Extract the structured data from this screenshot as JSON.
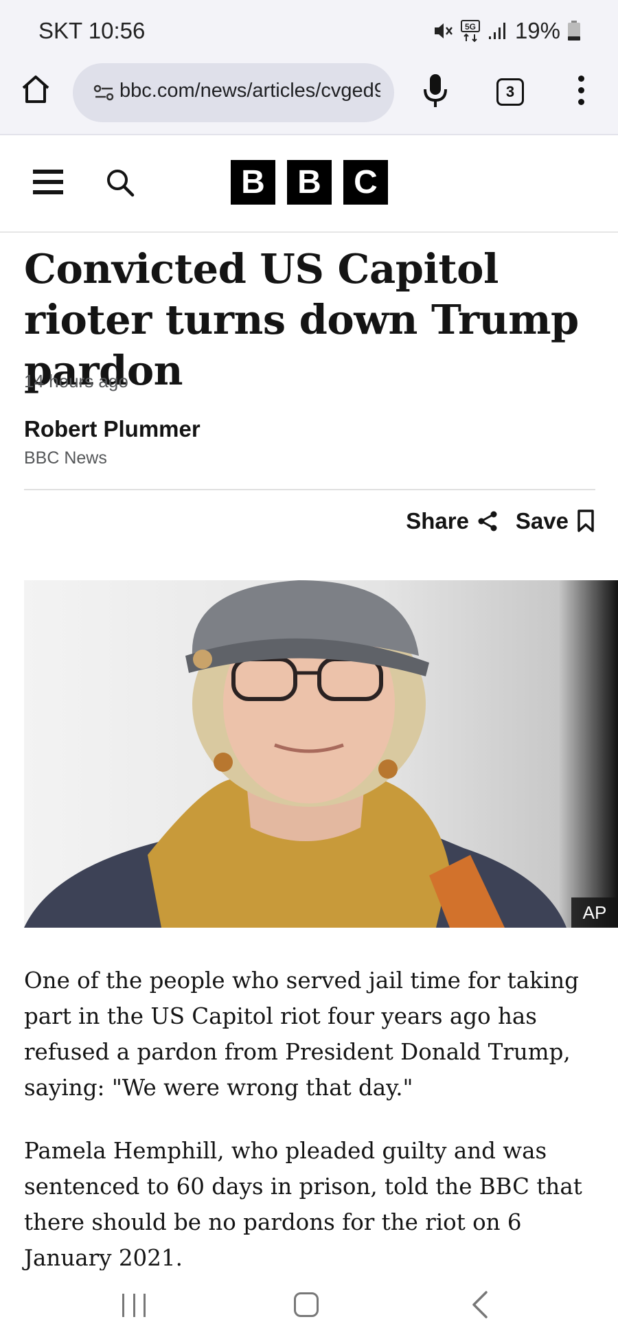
{
  "status_bar": {
    "carrier_time": "SKT 10:56",
    "network": "5G",
    "battery": "19%"
  },
  "browser": {
    "url": "bbc.com/news/articles/cvged9",
    "tab_count": "3"
  },
  "site": {
    "logo_letters": [
      "B",
      "B",
      "C"
    ]
  },
  "article": {
    "headline": "Convicted US Capitol rioter turns down Trump pardon",
    "timestamp": "14 hours ago",
    "author": "Robert Plummer",
    "outlet": "BBC News",
    "share_label": "Share",
    "save_label": "Save",
    "image_credit": "AP",
    "paragraphs": [
      "One of the people who served jail time for taking part in the US Capitol riot four years ago has refused a pardon from President Donald Trump, saying: \"We were wrong that day.\"",
      "Pamela Hemphill, who pleaded guilty and was sentenced to 60 days in prison, told the BBC that there should be no pardons for the riot on 6 January 2021."
    ]
  },
  "icons": {
    "home": "home-icon",
    "site_settings": "site-settings-icon",
    "mic": "mic-icon",
    "tabs": "tabs-icon",
    "overflow": "more-vert-icon",
    "menu": "hamburger-icon",
    "search": "search-icon",
    "share": "share-icon",
    "save": "bookmark-icon"
  }
}
